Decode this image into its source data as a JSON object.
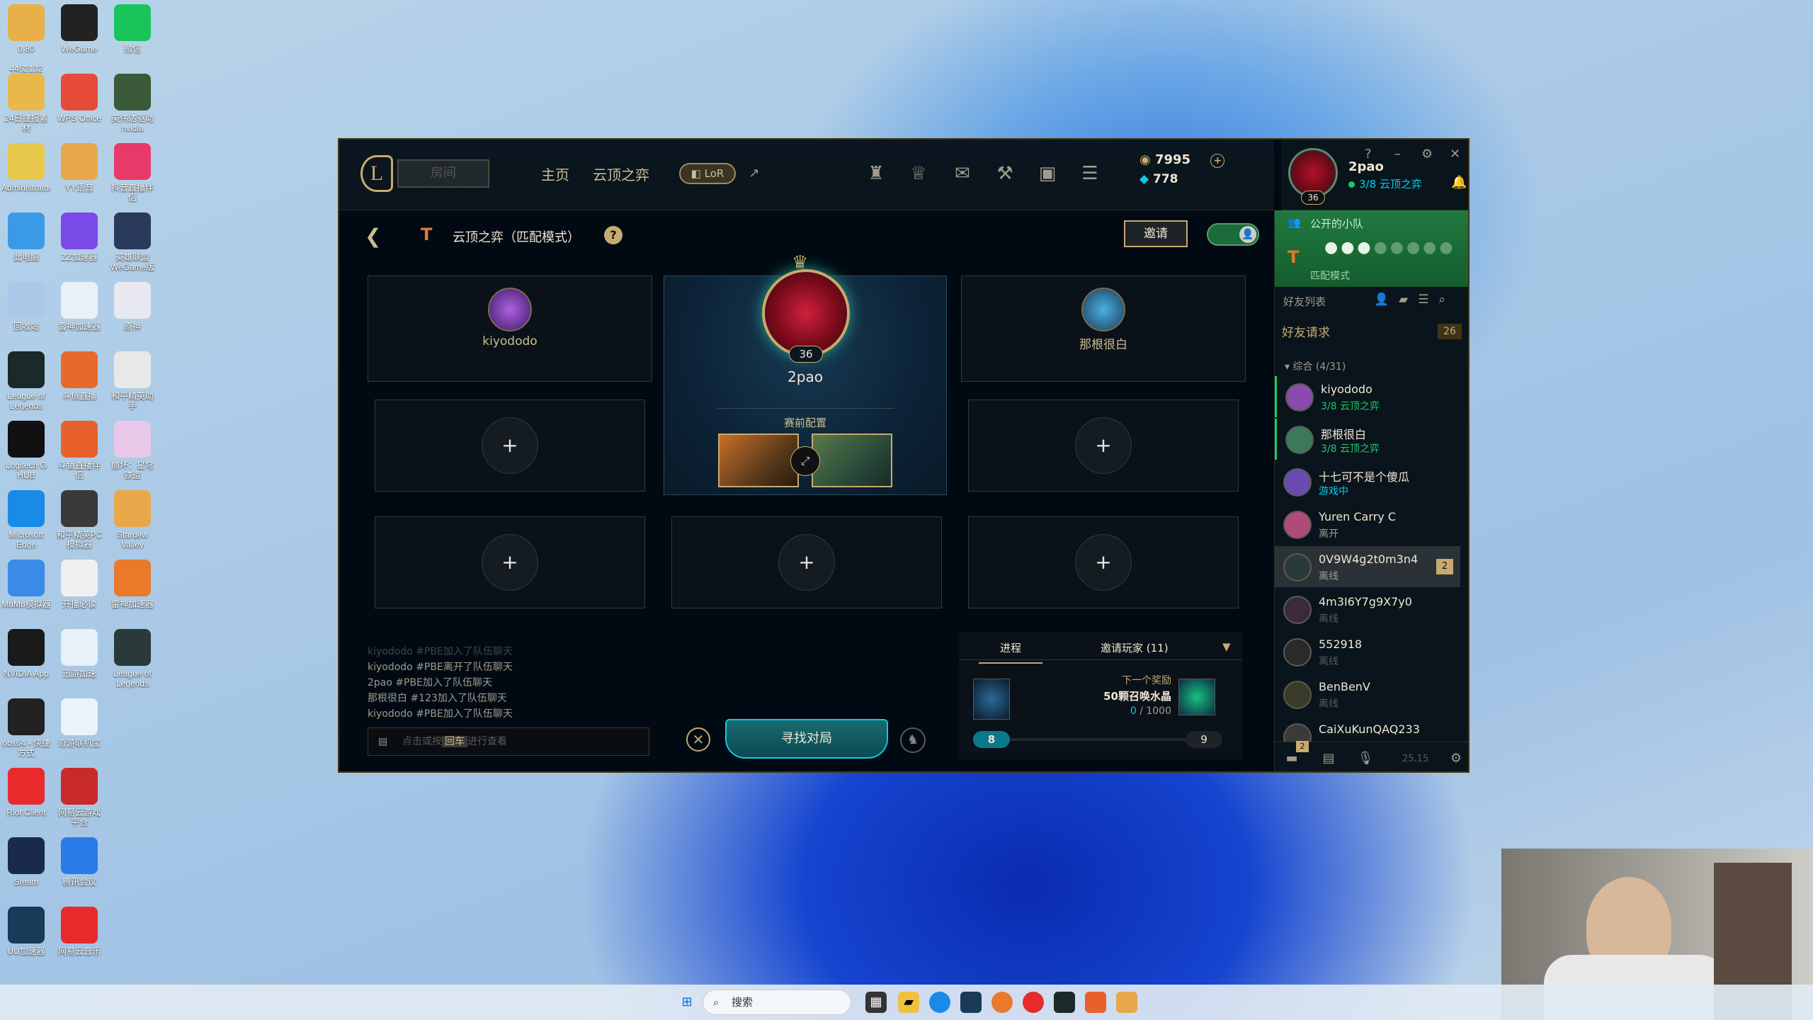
{
  "desktop_icons": [
    {
      "label": "0.80",
      "sub": "4452132",
      "color": "#e8b04a"
    },
    {
      "label": "WeGame",
      "color": "#222"
    },
    {
      "label": "微信",
      "color": "#19c45a"
    },
    {
      "label": "24日捷报素材",
      "color": "#e8b84a"
    },
    {
      "label": "WPS Office",
      "color": "#e84a3a"
    },
    {
      "label": "英伟达驱动 nvidia",
      "color": "#3a5a3a"
    },
    {
      "label": "Administrator",
      "color": "#e8c84a"
    },
    {
      "label": "YY语音",
      "color": "#e8a84a"
    },
    {
      "label": "抖音直播伴侣",
      "color": "#e83a6a"
    },
    {
      "label": "此电脑",
      "color": "#3a9ae8"
    },
    {
      "label": "ZZ加速器",
      "color": "#7a4ae8"
    },
    {
      "label": "英雄联盟WeGame版",
      "color": "#2a3a5a"
    },
    {
      "label": "回收站",
      "color": "#aac8e8"
    },
    {
      "label": "雷神加速器",
      "color": "#e8f0f8"
    },
    {
      "label": "原神",
      "color": "#e8e8f0"
    },
    {
      "label": "League of Legends",
      "color": "#1a2a2a"
    },
    {
      "label": "斗鱼直播",
      "color": "#e86a2a"
    },
    {
      "label": "和平精英助手",
      "color": "#e8e8e8"
    },
    {
      "label": "Logitech G HUB",
      "color": "#111"
    },
    {
      "label": "斗鱼直播伴侣",
      "color": "#e8602a"
    },
    {
      "label": "崩坏：星穹铁道",
      "color": "#e8c8e8"
    },
    {
      "label": "Microsoft Edge",
      "color": "#1a8ae8"
    },
    {
      "label": "和平精英PC模拟器",
      "color": "#3a3a3a"
    },
    {
      "label": "Stardew Valley",
      "color": "#e8a84a"
    },
    {
      "label": "MuMu模拟器",
      "color": "#3a8ae8"
    },
    {
      "label": "开播必读",
      "color": "#f0f0f0"
    },
    {
      "label": "雷神加速器",
      "color": "#e87a2a"
    },
    {
      "label": "NVIDIA App",
      "color": "#1a1a1a"
    },
    {
      "label": "迅游加速",
      "color": "#e8f0f8"
    },
    {
      "label": "League of Legends",
      "color": "#2a3a3a"
    },
    {
      "label": "obs64 - 快捷方式",
      "color": "#222"
    },
    {
      "label": "奇游联机宝",
      "color": "#e8f4f8"
    },
    {
      "label": "Riot Client",
      "color": "#e82a2a"
    },
    {
      "label": "网易云游戏平台",
      "color": "#c82a2a"
    },
    {
      "label": "Steam",
      "color": "#1a2a4a"
    },
    {
      "label": "腾讯会议",
      "color": "#2a7ae8"
    },
    {
      "label": "UU加速器",
      "color": "#1a3a5a"
    },
    {
      "label": "网易云音乐",
      "color": "#e82a2a"
    }
  ],
  "client": {
    "play_button": "房间",
    "nav": {
      "home": "主页",
      "tft": "云顶之弈",
      "lor": "LoR"
    },
    "currency": {
      "be": "7995",
      "rp": "778"
    },
    "profile": {
      "name": "2pao",
      "level": "36",
      "status": "3/8 云顶之弈"
    },
    "window": {
      "help": "?",
      "min": "–",
      "settings": "⚙",
      "close": "✕"
    },
    "lobby": {
      "mode_title": "云顶之弈（匹配模式）",
      "invite": "邀请",
      "members": {
        "left": "kiyododo",
        "center": "2pao",
        "center_level": "36",
        "right": "那根很白"
      },
      "preconfig": "赛前配置",
      "find_match": "寻找对局"
    },
    "chat": {
      "lines": [
        "kiyododo #PBE加入了队伍聊天",
        "kiyododo #PBE离开了队伍聊天",
        "2pao #PBE加入了队伍聊天",
        "那根很白 #123加入了队伍聊天",
        "kiyododo #PBE加入了队伍聊天"
      ],
      "placeholder_a": "点击或按",
      "key": "回车",
      "placeholder_b": "进行查看"
    },
    "progress": {
      "tab1": "进程",
      "tab2": "邀请玩家 (11)",
      "next_label": "下一个奖励",
      "reward": "50颗召唤水晶",
      "current": "0",
      "total": "/ 1000",
      "fill_fraction": 0.02,
      "level_current": "8",
      "level_next": "9"
    },
    "social": {
      "party_title": "公开的小队",
      "party_mode": "匹配模式",
      "friends_list": "好友列表",
      "friend_requests": "好友请求",
      "friend_requests_count": "26",
      "group": "综合 (4/31)",
      "friends": [
        {
          "name": "kiyododo",
          "status": "3/8 云顶之弈",
          "color": "#1ec86a"
        },
        {
          "name": "那根很白",
          "status": "3/8 云顶之弈",
          "color": "#1ec86a"
        },
        {
          "name": "十七可不是个傻瓜",
          "status": "游戏中",
          "color": "#0acbe6"
        },
        {
          "name": "Yuren Carry C",
          "status": "离开",
          "color": "#a09b8c"
        },
        {
          "name": "0V9W4g2t0m3n4",
          "status": "离线",
          "color": "#a09b8c",
          "badge": "2"
        },
        {
          "name": "4m3I6Y7g9X7y0",
          "status": "离线",
          "color": "#5b5a56"
        },
        {
          "name": "552918",
          "status": "离线",
          "color": "#5b5a56"
        },
        {
          "name": "BenBenV",
          "status": "离线",
          "color": "#5b5a56"
        },
        {
          "name": "CaiXuKunQAQ233",
          "status": "",
          "color": "#5b5a56"
        }
      ],
      "footer_badge": "2",
      "version": "25.15"
    }
  },
  "taskbar": {
    "search": "搜索"
  }
}
